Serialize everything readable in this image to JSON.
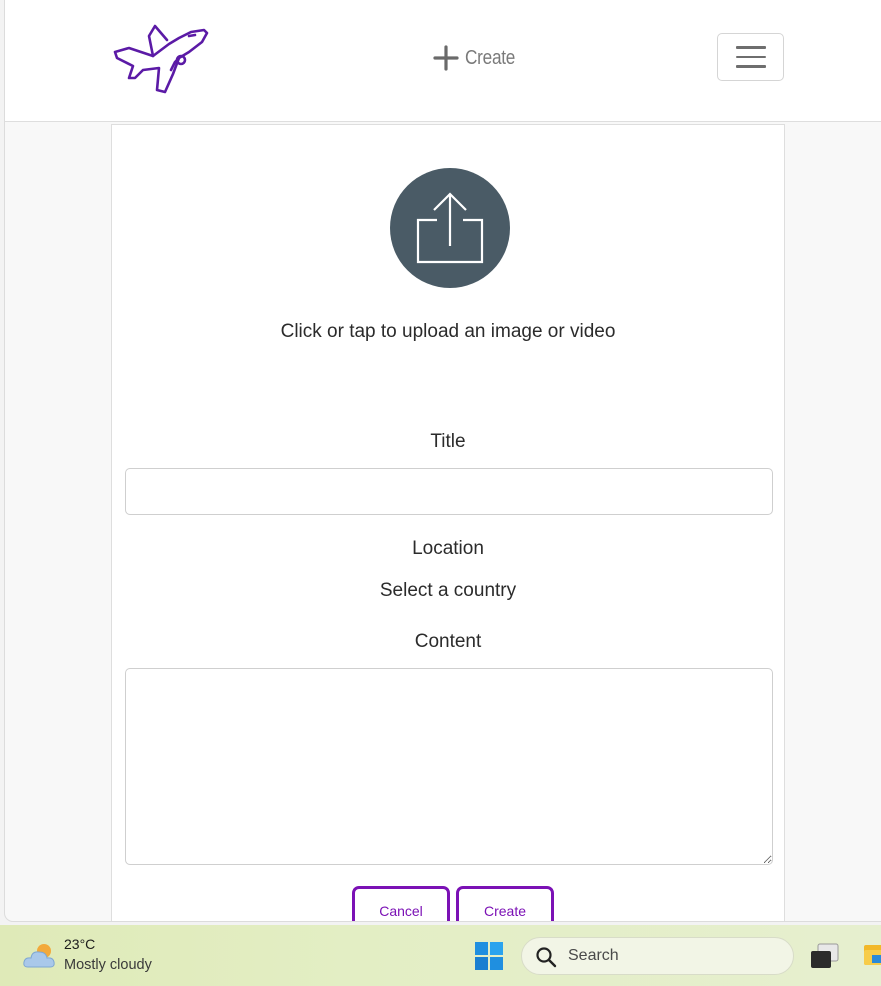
{
  "navbar": {
    "logo_icon": "airplane-icon",
    "create_label": "Create",
    "create_icon": "plus-icon",
    "menu_icon": "hamburger-icon"
  },
  "form": {
    "upload_icon": "upload-icon",
    "upload_text": "Click or tap to upload an image or video",
    "title_label": "Title",
    "title_value": "",
    "location_label": "Location",
    "country_select": "Select a country",
    "content_label": "Content",
    "content_value": "",
    "cancel_label": "Cancel",
    "create_label": "Create",
    "accent_color": "#7b11b5"
  },
  "taskbar": {
    "temperature": "23°C",
    "weather": "Mostly cloudy",
    "weather_icon": "partly-cloudy-icon",
    "search_placeholder": "Search"
  }
}
